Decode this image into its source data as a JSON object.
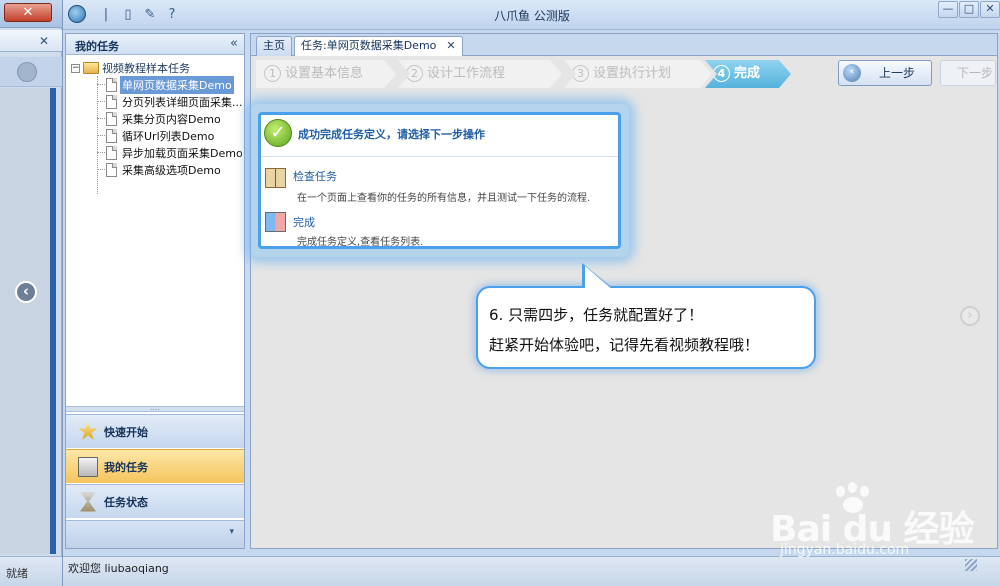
{
  "back_window": {
    "close_glyph": "✕",
    "panel_close_glyph": "✕",
    "nav_prev_glyph": "‹",
    "status_text": "就绪"
  },
  "titlebar": {
    "title": "八爪鱼 公测版",
    "window_buttons": [
      "—",
      "□",
      "✕"
    ]
  },
  "left_pane": {
    "title": "我的任务",
    "collapse_glyph": "«",
    "tree_root": "视频教程样本任务",
    "tree_items": [
      "单网页数据采集Demo",
      "分页列表详细页面采集...",
      "采集分页内容Demo",
      "循环Url列表Demo",
      "异步加载页面采集Demo",
      "采集高级选项Demo"
    ],
    "selected_index": 0,
    "nav_buttons": [
      {
        "label": "快速开始",
        "icon": "star-icon"
      },
      {
        "label": "我的任务",
        "icon": "tasks-icon"
      },
      {
        "label": "任务状态",
        "icon": "hourglass-icon"
      }
    ],
    "active_nav_index": 1,
    "footer_glyph": "▾"
  },
  "tabs": {
    "home": "主页",
    "task": "任务:单网页数据采集Demo",
    "close_glyph": "✕"
  },
  "wizard": {
    "steps": [
      {
        "num": "1",
        "label": "设置基本信息"
      },
      {
        "num": "2",
        "label": "设计工作流程"
      },
      {
        "num": "3",
        "label": "设置执行计划"
      },
      {
        "num": "4",
        "label": "完成"
      }
    ],
    "current_step": 4,
    "prev_button": "上一步",
    "next_button": "下一步",
    "prev_glyph": "‹",
    "nav_next_glyph": "›"
  },
  "popup": {
    "title": "成功完成任务定义，请选择下一步操作",
    "check_glyph": "✓",
    "rows": [
      {
        "title": "检查任务",
        "desc": "在一个页面上查看你的任务的所有信息，并且测试一下任务的流程."
      },
      {
        "title": "完成",
        "desc": "完成任务定义,查看任务列表."
      }
    ]
  },
  "callout": {
    "line1": "6. 只需四步，任务就配置好了！",
    "line2": "赶紧开始体验吧，记得先看视频教程哦！"
  },
  "statusbar": {
    "text": "欢迎您 liubaoqiang"
  },
  "watermark": {
    "logo": "Bai du 经验",
    "url": "jingyan.baidu.com"
  },
  "colors": {
    "accent_blue": "#4aa0ec",
    "step_active": "#56b2dc",
    "nav_active": "#f5c45d",
    "selection": "#6a9ad6"
  }
}
